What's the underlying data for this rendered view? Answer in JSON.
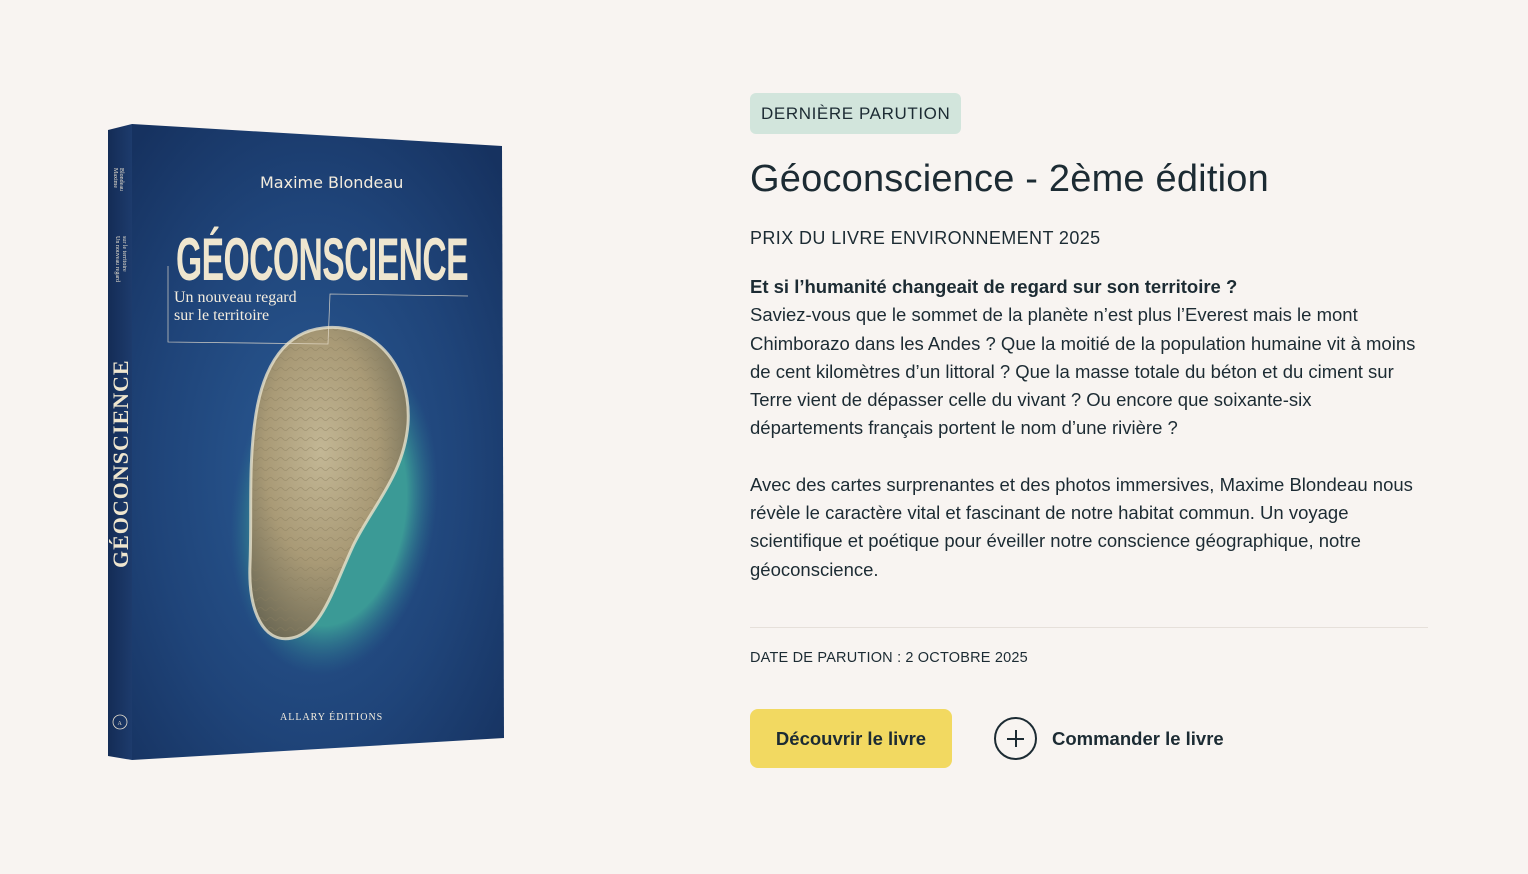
{
  "book": {
    "author": "Maxime Blondeau",
    "cover_title": "GÉOCONSCIENCE",
    "cover_subtitle_line1": "Un nouveau regard",
    "cover_subtitle_line2": "sur le territoire",
    "publisher": "ALLARY ÉDITIONS",
    "spine_title": "GÉOCONSCIENCE",
    "spine_author_line1": "Maxime",
    "spine_author_line2": "Blondeau",
    "spine_subtitle_line1": "Un nouveau regard",
    "spine_subtitle_line2": "sur le territoire",
    "spine_logo": "A",
    "colors": {
      "cover": "#1f3f72",
      "cover_dark": "#132a53",
      "island": "#b9ad8d",
      "lagoon": "#3f9c9a"
    }
  },
  "badge": "DERNIÈRE PARUTION",
  "title": "Géoconscience - 2ème édition",
  "prize": "PRIX DU LIVRE ENVIRONNEMENT 2025",
  "description": {
    "lead": "Et si l’humanité changeait de regard sur son territoire ?",
    "paragraph1": "Saviez-vous que le sommet de la planète n’est plus l’Everest mais le mont Chimborazo dans les Andes ? Que la moitié de la population humaine vit à moins de cent kilomètres d’un littoral ? Que la masse totale du béton et du ciment sur Terre vient de dépasser celle du vivant ? Ou encore que soixante-six départements français portent le nom d’une rivière ?",
    "paragraph2": "Avec des cartes surprenantes et des photos immersives, Maxime Blondeau nous révèle le caractère vital et fascinant de notre habitat commun. Un voyage scientifique et poétique pour éveiller notre conscience géographique, notre géoconscience."
  },
  "release": {
    "label": "DATE DE PARUTION :",
    "date": "2 OCTOBRE 2025"
  },
  "actions": {
    "primary_label": "Découvrir le livre",
    "secondary_label": "Commander le livre",
    "secondary_icon": "plus-circle-icon"
  },
  "colors": {
    "background": "#f8f4f1",
    "text": "#1c2b33",
    "badge_bg": "#d2e5dc",
    "primary_button": "#f2d961"
  }
}
